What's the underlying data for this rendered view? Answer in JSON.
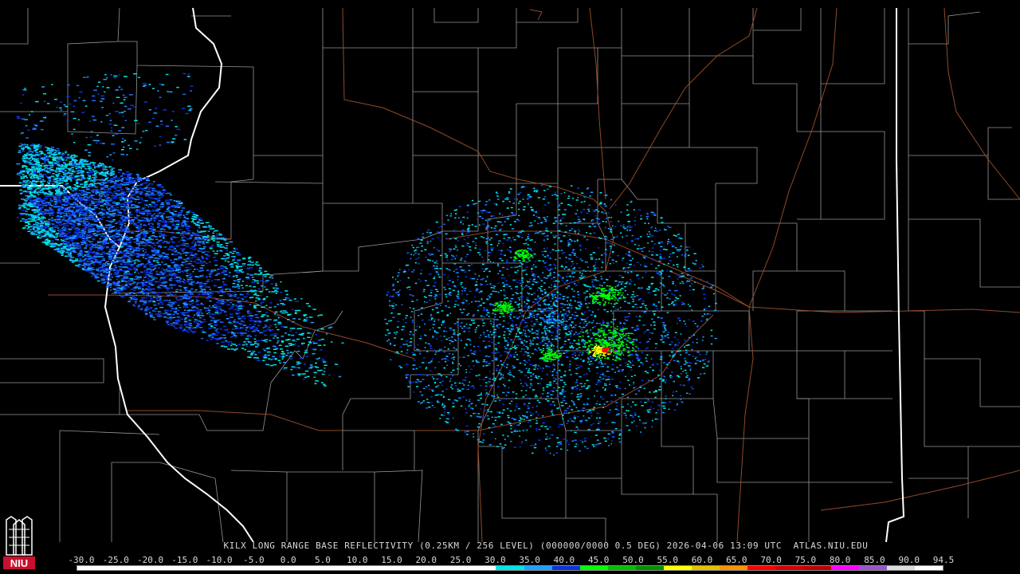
{
  "caption": {
    "title": "KILX LONG RANGE BASE REFLECTIVITY (0.25KM / 256 LEVEL) (000000/0000 0.5 DEG) 2026-04-06 13:09 UTC",
    "source": "ATLAS.NIU.EDU"
  },
  "legend": {
    "ticks": [
      "-30.0",
      "-25.0",
      "-20.0",
      "-15.0",
      "-10.0",
      "-5.0",
      "0.0",
      "5.0",
      "10.0",
      "15.0",
      "20.0",
      "25.0",
      "30.0",
      "35.0",
      "40.0",
      "45.0",
      "50.0",
      "55.0",
      "60.0",
      "65.0",
      "70.0",
      "75.0",
      "80.0",
      "85.0",
      "90.0",
      "94.5"
    ],
    "colors": [
      "#ffffff",
      "#ffffff",
      "#ffffff",
      "#ffffff",
      "#ffffff",
      "#ffffff",
      "#ffffff",
      "#ffffff",
      "#ffffff",
      "#ffffff",
      "#ffffff",
      "#ffffff",
      "#ffffff",
      "#ffffff",
      "#ffffff",
      "#00e5e5",
      "#1ea0ff",
      "#0a34e0",
      "#00ff00",
      "#00c000",
      "#009000",
      "#ffff00",
      "#e7c000",
      "#ff9000",
      "#ff0000",
      "#d60000",
      "#c00000",
      "#ff00ff",
      "#9955c9",
      "#dddddd",
      "#ffffff"
    ]
  },
  "logo": {
    "text": "NIU"
  }
}
